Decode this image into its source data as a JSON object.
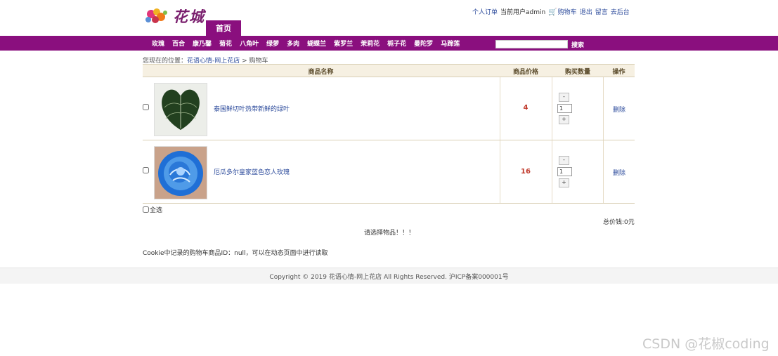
{
  "header": {
    "logo_text": "花城",
    "top_links": {
      "orders": "个人订单",
      "current_user": "当前用户admin",
      "cart": "购物车",
      "logout": "退出",
      "message": "留言",
      "admin": "去后台"
    },
    "home_tab": "首页"
  },
  "nav": {
    "items": [
      "玫瑰",
      "百合",
      "康乃馨",
      "菊花",
      "八角叶",
      "绿萝",
      "多肉",
      "蝴蝶兰",
      "紫罗兰",
      "茉莉花",
      "栀子花",
      "曼陀罗",
      "马蹄莲"
    ],
    "search_value": "",
    "search_label": "搜索"
  },
  "breadcrumb": {
    "prefix": "您现在的位置：",
    "site": "花语心情-网上花店",
    "sep": " > ",
    "current": "购物车"
  },
  "table": {
    "headers": {
      "name": "商品名称",
      "price": "商品价格",
      "qty": "购买数量",
      "action": "操作"
    },
    "rows": [
      {
        "name": "泰国鲜切叶热带新鲜的绿叶",
        "price": "4",
        "qty": "1",
        "minus": "-",
        "plus": "+",
        "delete": "删除"
      },
      {
        "name": "厄瓜多尔皇家蓝色恋人玫瑰",
        "price": "16",
        "qty": "1",
        "minus": "-",
        "plus": "+",
        "delete": "删除"
      }
    ]
  },
  "select_all_label": "全选",
  "total_label": "总价钱:0元",
  "notice": "请选择物品！！！",
  "cookie_note": "Cookie中记录的购物车商品ID：null，可以在动态页面中进行读取",
  "footer": "Copyright © 2019 花语心情-网上花店 All Rights Reserved. 沪ICP备案000001号",
  "watermark": "CSDN @花椒coding",
  "colors": {
    "brand_purple": "#8a0f7e",
    "link_blue": "#2b4a9b",
    "price_red": "#c0392b"
  }
}
